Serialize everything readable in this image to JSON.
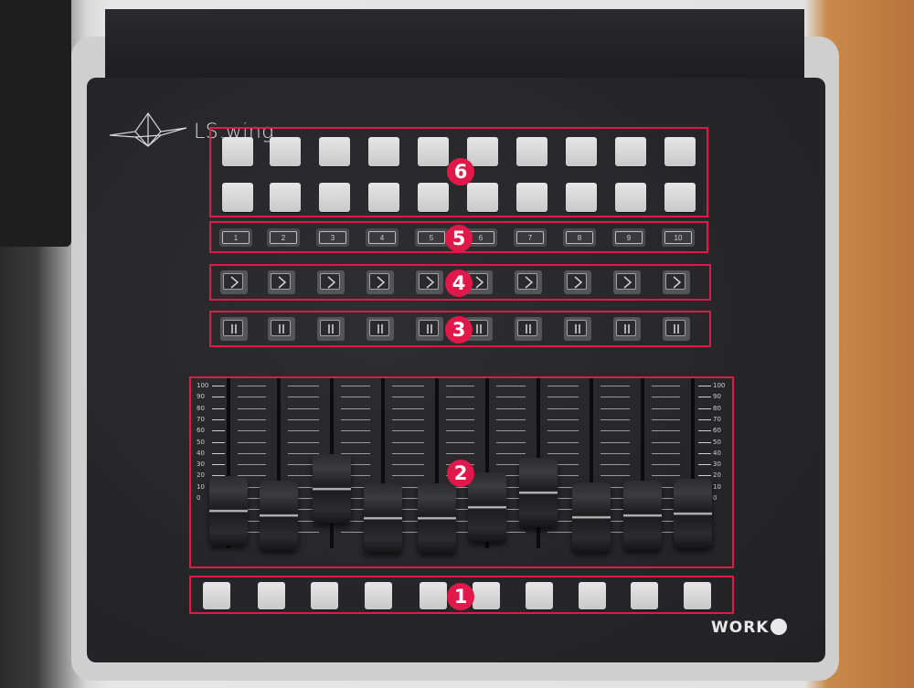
{
  "brand": {
    "model": "LS.wing",
    "maker": "WORK"
  },
  "zones": [
    {
      "id": 6,
      "label": "6"
    },
    {
      "id": 5,
      "label": "5"
    },
    {
      "id": 4,
      "label": "4"
    },
    {
      "id": 3,
      "label": "3"
    },
    {
      "id": 2,
      "label": "2"
    },
    {
      "id": 1,
      "label": "1"
    }
  ],
  "number_keys": [
    "1",
    "2",
    "3",
    "4",
    "5",
    "6",
    "7",
    "8",
    "9",
    "10"
  ],
  "fader_scale": [
    "100",
    "90",
    "80",
    "70",
    "60",
    "50",
    "40",
    "30",
    "20",
    "10",
    "0"
  ],
  "fader_levels": [
    0.15,
    0.1,
    0.35,
    0.08,
    0.08,
    0.18,
    0.32,
    0.09,
    0.1,
    0.12
  ],
  "colors": {
    "zone_outline": "#e0194a",
    "panel": "#262628",
    "pad": "#d8d8d8"
  },
  "icons": {
    "go": "chevron-right-icon",
    "pause": "pause-icon",
    "logo": "bird-logo-icon"
  }
}
